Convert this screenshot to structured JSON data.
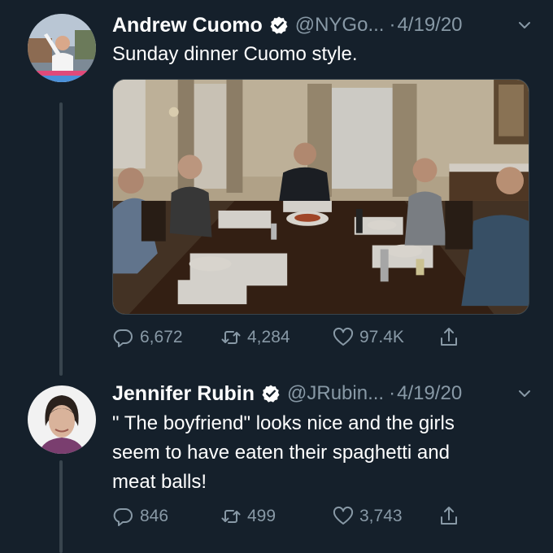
{
  "tweets": [
    {
      "name": "Andrew Cuomo",
      "handle": "@NYGo...",
      "separator": "·",
      "date": "4/19/20",
      "text": "Sunday dinner Cuomo style.",
      "stats": {
        "replies": "6,672",
        "retweets": "4,284",
        "likes": "97.4K"
      }
    },
    {
      "name": "Jennifer Rubin",
      "handle": "@JRubin...",
      "separator": "·",
      "date": "4/19/20",
      "text_lines": [
        "\" The boyfriend\" looks nice and the girls",
        "seem to have eaten their spaghetti and",
        "meat balls!"
      ],
      "stats": {
        "replies": "846",
        "retweets": "499",
        "likes": "3,743"
      }
    }
  ],
  "colors": {
    "background": "#15202b",
    "secondary_text": "#8899a6",
    "verified_badge": "#ffffff",
    "thread_line": "#38444d"
  },
  "icons": [
    "verified-badge-icon",
    "chevron-down-icon",
    "reply-icon",
    "retweet-icon",
    "like-icon",
    "share-icon"
  ]
}
